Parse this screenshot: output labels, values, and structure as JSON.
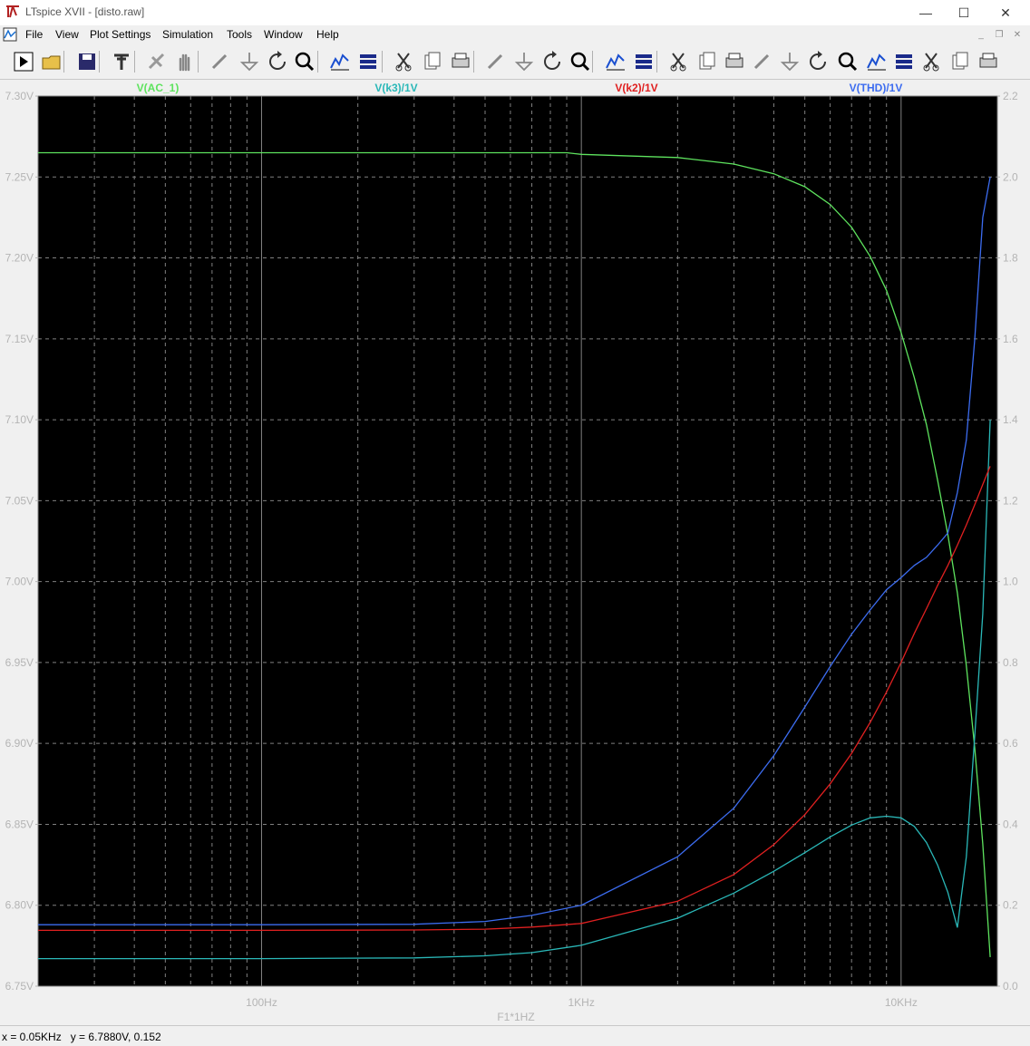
{
  "window": {
    "title": "LTspice XVII - [disto.raw]",
    "minimize_glyph": "—",
    "maximize_glyph": "☐",
    "close_glyph": "✕"
  },
  "menu": [
    "File",
    "View",
    "Plot Settings",
    "Simulation",
    "Tools",
    "Window",
    "Help"
  ],
  "toolbar_icons": [
    "run-icon",
    "open-icon",
    "save-icon",
    "control-panel-icon",
    "halt-icon",
    "pan-icon",
    "zoom-in-icon",
    "zoom-fit-icon",
    "zoom-out-icon",
    "cancel-zoom-icon",
    "autorange-icon",
    "plot-settings-icon",
    "tile-horizontal-icon",
    "cascade-icon",
    "tile-vertical-icon",
    "cut-icon",
    "copy-icon",
    "paste-icon",
    "find-icon",
    "print-preview-icon",
    "print-icon",
    "wire-icon",
    "ground-icon",
    "label-icon",
    "resistor-icon",
    "capacitor-icon",
    "inductor-icon",
    "diode-icon",
    "component-icon",
    "move-icon",
    "drag-icon",
    "undo-icon",
    "redo-icon"
  ],
  "status": {
    "x": "x = 0.05KHz",
    "y": "y = 6.7880V, 0.152"
  },
  "colors": {
    "plot_bg": "#000000",
    "grid": "#808080",
    "axis_text": "#b4b4b4",
    "ac1": "#5ee35e",
    "k3": "#2ab8b8",
    "k2": "#e02020",
    "thd": "#3c6cf0"
  },
  "chart_data": {
    "type": "line",
    "x_scale": "log",
    "xlabel": "F1*1HZ",
    "xlim": [
      20,
      20000
    ],
    "x_ticks": [
      {
        "value": 100,
        "label": "100Hz"
      },
      {
        "value": 1000,
        "label": "1KHz"
      },
      {
        "value": 10000,
        "label": "10KHz"
      }
    ],
    "left_axis": {
      "ylim": [
        6.75,
        7.3
      ],
      "ticks": [
        "7.30V",
        "7.25V",
        "7.20V",
        "7.15V",
        "7.10V",
        "7.05V",
        "7.00V",
        "6.95V",
        "6.90V",
        "6.85V",
        "6.80V",
        "6.75V"
      ]
    },
    "right_axis": {
      "ylim": [
        0.0,
        2.2
      ],
      "ticks": [
        "2.2",
        "2.0",
        "1.8",
        "1.6",
        "1.4",
        "1.2",
        "1.0",
        "0.8",
        "0.6",
        "0.4",
        "0.2",
        "0.0"
      ]
    },
    "grid": true,
    "series": [
      {
        "name": "V(AC_1)",
        "axis": "left",
        "color": "#5ee35e",
        "x": [
          20,
          100,
          500,
          900,
          1000,
          2000,
          3000,
          4000,
          5000,
          6000,
          7000,
          8000,
          9000,
          10000,
          11000,
          12000,
          13000,
          14000,
          15000,
          16000,
          17000,
          18000,
          19000
        ],
        "y": [
          7.265,
          7.265,
          7.265,
          7.265,
          7.264,
          7.262,
          7.258,
          7.252,
          7.244,
          7.233,
          7.219,
          7.201,
          7.18,
          7.154,
          7.126,
          7.097,
          7.063,
          7.029,
          6.993,
          6.948,
          6.897,
          6.838,
          6.768
        ]
      },
      {
        "name": "V(k3)/1V",
        "axis": "right",
        "color": "#2ab8b8",
        "x": [
          20,
          100,
          300,
          500,
          700,
          1000,
          2000,
          3000,
          4000,
          5000,
          6000,
          7000,
          8000,
          9000,
          10000,
          11000,
          12000,
          13000,
          14000,
          15000,
          16000,
          17000,
          18000,
          19000
        ],
        "y": [
          0.068,
          0.068,
          0.07,
          0.075,
          0.083,
          0.101,
          0.168,
          0.23,
          0.284,
          0.33,
          0.369,
          0.398,
          0.416,
          0.42,
          0.416,
          0.395,
          0.355,
          0.3,
          0.232,
          0.145,
          0.32,
          0.62,
          0.92,
          1.4
        ]
      },
      {
        "name": "V(k2)/1V",
        "axis": "right",
        "color": "#e02020",
        "x": [
          20,
          100,
          300,
          500,
          700,
          1000,
          2000,
          3000,
          4000,
          5000,
          6000,
          7000,
          8000,
          9000,
          10000,
          11000,
          12000,
          13000,
          14000,
          15000,
          16000,
          17000,
          18000,
          19000
        ],
        "y": [
          0.138,
          0.138,
          0.139,
          0.141,
          0.146,
          0.155,
          0.21,
          0.276,
          0.35,
          0.424,
          0.5,
          0.575,
          0.652,
          0.727,
          0.8,
          0.872,
          0.933,
          0.99,
          1.04,
          1.09,
          1.14,
          1.19,
          1.24,
          1.285
        ]
      },
      {
        "name": "V(THD)/1V",
        "axis": "right",
        "color": "#3c6cf0",
        "x": [
          20,
          100,
          300,
          500,
          700,
          1000,
          2000,
          3000,
          4000,
          5000,
          6000,
          7000,
          8000,
          9000,
          10000,
          11000,
          12000,
          13000,
          14000,
          15000,
          16000,
          17000,
          18000,
          19000
        ],
        "y": [
          0.152,
          0.152,
          0.153,
          0.16,
          0.175,
          0.2,
          0.32,
          0.44,
          0.57,
          0.69,
          0.79,
          0.87,
          0.93,
          0.98,
          1.01,
          1.04,
          1.06,
          1.09,
          1.12,
          1.22,
          1.35,
          1.6,
          1.9,
          2.0
        ]
      }
    ]
  }
}
